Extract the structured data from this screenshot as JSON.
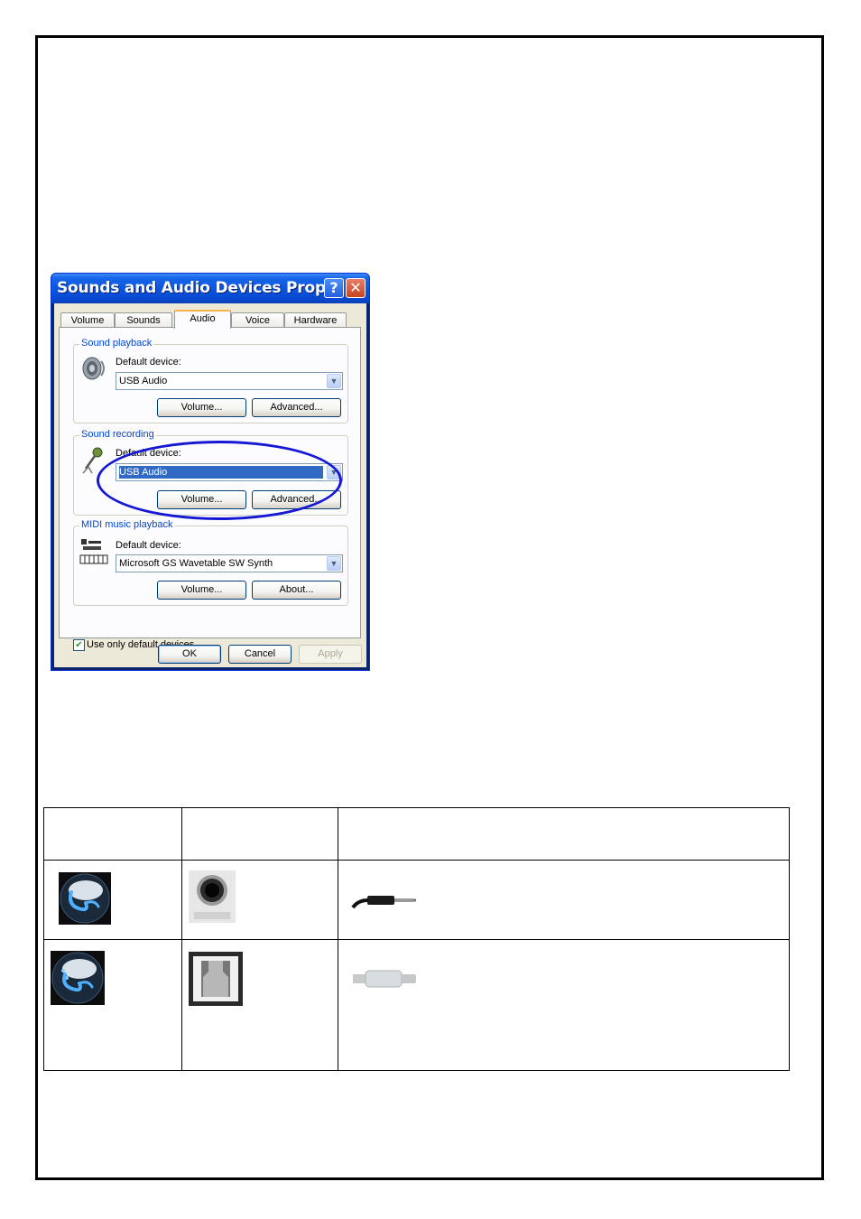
{
  "dialog": {
    "title": "Sounds and Audio Devices Prop…",
    "help_glyph": "?",
    "close_glyph": "✕",
    "tabs": [
      "Volume",
      "Sounds",
      "Audio",
      "Voice",
      "Hardware"
    ],
    "active_tab": "Audio",
    "sound_playback": {
      "title": "Sound playback",
      "default_label": "Default device:",
      "device": "USB Audio",
      "volume_button": "Volume...",
      "advanced_button": "Advanced..."
    },
    "sound_recording": {
      "title": "Sound recording",
      "default_label": "Default device:",
      "device": "USB Audio",
      "volume_button": "Volume...",
      "advanced_button": "Advanced..."
    },
    "midi_playback": {
      "title": "MIDI music playback",
      "default_label": "Default device:",
      "device": "Microsoft GS Wavetable SW Synth",
      "volume_button": "Volume...",
      "about_button": "About..."
    },
    "use_only_default": {
      "label": "Use only default devices",
      "checked": true
    },
    "ok_button": "OK",
    "cancel_button": "Cancel",
    "apply_button": "Apply"
  },
  "annotation": {
    "highlight_color": "#1418d4"
  },
  "icons": {
    "playback": "speaker-icon",
    "recording": "microphone-icon",
    "midi": "midi-keyboard-icon"
  }
}
